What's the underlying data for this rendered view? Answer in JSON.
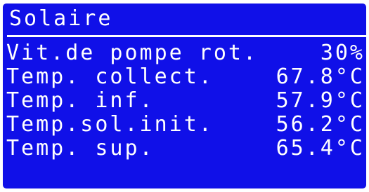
{
  "screen": {
    "title": "Solaire",
    "background_color": "#1010e8",
    "text_color": "#ffffff",
    "rows": [
      {
        "label": "Vit.de pompe rot.",
        "value": "30%"
      },
      {
        "label": "Temp. collect.",
        "value": "67.8°C"
      },
      {
        "label": "Temp. inf.",
        "value": "57.9°C"
      },
      {
        "label": "Temp.sol.init.",
        "value": "56.2°C"
      },
      {
        "label": "Temp. sup.",
        "value": "65.4°C"
      }
    ]
  }
}
